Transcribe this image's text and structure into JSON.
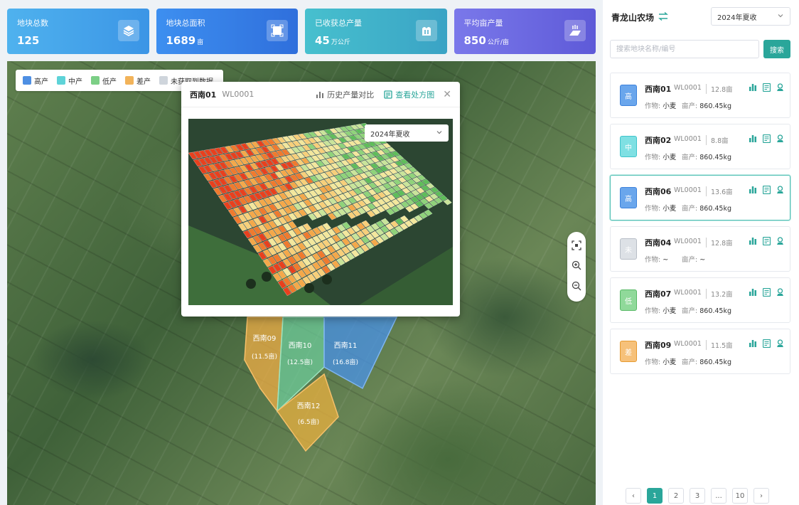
{
  "stats": [
    {
      "label": "地块总数",
      "value": "125",
      "unit": "",
      "icon": "layers-icon"
    },
    {
      "label": "地块总面积",
      "value": "1689",
      "unit": "亩",
      "icon": "area-frame-icon"
    },
    {
      "label": "已收获总产量",
      "value": "45",
      "unit": "万公斤",
      "icon": "harvest-icon"
    },
    {
      "label": "平均亩产量",
      "value": "850",
      "unit": "公斤/亩",
      "icon": "field-yield-icon"
    }
  ],
  "legend": [
    {
      "label": "高产",
      "color": "#4e8fe3"
    },
    {
      "label": "中产",
      "color": "#5ed3d8"
    },
    {
      "label": "低产",
      "color": "#7ccf86"
    },
    {
      "label": "差产",
      "color": "#f2b35a"
    },
    {
      "label": "未获取到数据",
      "color": "#cfd5dc"
    }
  ],
  "popup": {
    "title": "西南01",
    "code": "WL0001",
    "history_label": "历史产量对比",
    "prescription_label": "查看处方图",
    "season": "2024年夏收"
  },
  "map_plots": [
    {
      "name": "西南09",
      "area": "(11.5亩)",
      "color": "#f0ad45"
    },
    {
      "name": "西南10",
      "area": "(12.5亩)",
      "color": "#6fd1a0"
    },
    {
      "name": "西南11",
      "area": "(16.8亩)",
      "color": "#4a93e8"
    },
    {
      "name": "西南12",
      "area": "(6.5亩)",
      "color": "#eab03f"
    }
  ],
  "panel": {
    "farm": "青龙山农场",
    "season": "2024年夏收",
    "search_placeholder": "搜索地块名称/编号",
    "search_button": "搜索",
    "crop_label": "作物:",
    "yield_label": "亩产:"
  },
  "plots": [
    {
      "name": "西南01",
      "code": "WL0001",
      "area": "12.8亩",
      "crop": "小麦",
      "yield": "860.45kg",
      "badge": "高",
      "color": "#6aa6ec",
      "border": "#3d82dc",
      "selected": false
    },
    {
      "name": "西南02",
      "code": "WL0001",
      "area": "8.8亩",
      "crop": "小麦",
      "yield": "860.45kg",
      "badge": "中",
      "color": "#7fe0e3",
      "border": "#3fc5cc",
      "selected": false
    },
    {
      "name": "西南06",
      "code": "WL0001",
      "area": "13.6亩",
      "crop": "小麦",
      "yield": "860.45kg",
      "badge": "高",
      "color": "#6aa6ec",
      "border": "#3d82dc",
      "selected": true
    },
    {
      "name": "西南04",
      "code": "WL0001",
      "area": "12.8亩",
      "crop": "~",
      "yield": "~",
      "badge": "未",
      "color": "#dde1e6",
      "border": "#b8bec7",
      "selected": false
    },
    {
      "name": "西南07",
      "code": "WL0001",
      "area": "13.2亩",
      "crop": "小麦",
      "yield": "860.45kg",
      "badge": "低",
      "color": "#90d99a",
      "border": "#57b965",
      "selected": false
    },
    {
      "name": "西南09",
      "code": "WL0001",
      "area": "11.5亩",
      "crop": "小麦",
      "yield": "860.45kg",
      "badge": "差",
      "color": "#f6c17a",
      "border": "#e69a30",
      "selected": false
    }
  ],
  "pagination": {
    "pages": [
      "1",
      "2",
      "3",
      "...",
      "10"
    ],
    "current": "1",
    "prev": "‹",
    "next": "›"
  }
}
